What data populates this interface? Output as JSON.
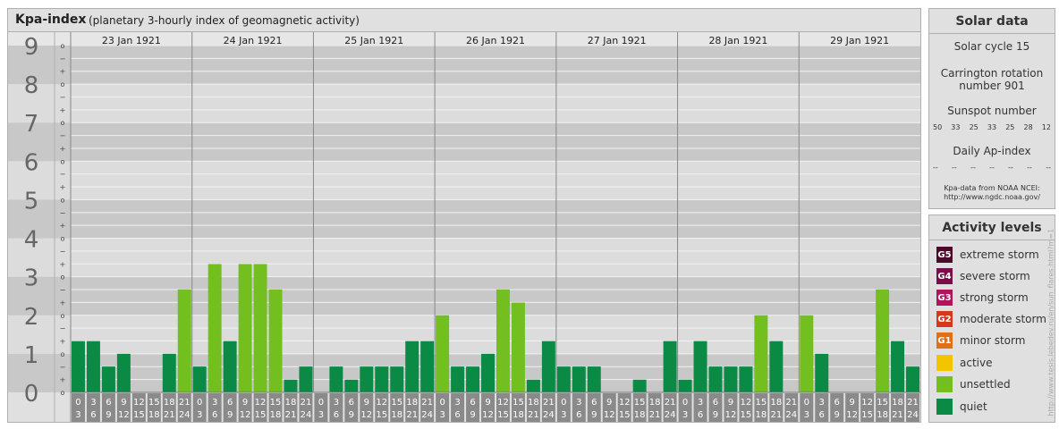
{
  "header": {
    "title": "Kpa-index",
    "subtitle": "(planetary 3-hourly index of geomagnetic activity)"
  },
  "chart_data": {
    "type": "bar",
    "title": "Kpa-index",
    "subtitle": "(planetary 3-hourly index of geomagnetic activity)",
    "ylim": [
      0,
      9
    ],
    "y_major_ticks": [
      "0",
      "1",
      "2",
      "3",
      "4",
      "5",
      "6",
      "7",
      "8",
      "9"
    ],
    "y_minor_tick_marks": [
      "o",
      "+",
      "−"
    ],
    "days": [
      "23 Jan 1921",
      "24 Jan 1921",
      "25 Jan 1921",
      "26 Jan 1921",
      "27 Jan 1921",
      "28 Jan 1921",
      "29 Jan 1921"
    ],
    "slot_start_labels": [
      "0",
      "3",
      "6",
      "9",
      "12",
      "15",
      "18",
      "21"
    ],
    "slot_end_labels": [
      "3",
      "6",
      "9",
      "12",
      "15",
      "18",
      "21",
      "24"
    ],
    "values": [
      [
        1.33,
        1.33,
        0.67,
        1.0,
        0.0,
        0.0,
        1.0,
        2.67
      ],
      [
        0.67,
        3.33,
        1.33,
        3.33,
        3.33,
        2.67,
        0.33,
        0.67
      ],
      [
        0.0,
        0.67,
        0.33,
        0.67,
        0.67,
        0.67,
        1.33,
        1.33
      ],
      [
        2.0,
        0.67,
        0.67,
        1.0,
        2.67,
        2.33,
        0.33,
        1.33
      ],
      [
        0.67,
        0.67,
        0.67,
        0.0,
        0.0,
        0.33,
        0.0,
        1.33
      ],
      [
        0.33,
        1.33,
        0.67,
        0.67,
        0.67,
        2.0,
        1.33,
        0.0
      ],
      [
        2.0,
        1.0,
        0.0,
        0.0,
        0.0,
        2.67,
        1.33,
        0.67
      ]
    ],
    "grid": true,
    "colors": {
      "quiet": "#0a8a44",
      "unsettled": "#72bf1f"
    }
  },
  "solar": {
    "title": "Solar data",
    "cycle": "Solar cycle 15",
    "carrington_line1": "Carrington rotation",
    "carrington_line2": "number 901",
    "sunspot_label": "Sunspot number",
    "sunspot_values": [
      "50",
      "33",
      "25",
      "33",
      "25",
      "28",
      "12"
    ],
    "ap_label": "Daily Ap-index",
    "ap_values": [
      "--",
      "--",
      "--",
      "--",
      "--",
      "--",
      "--"
    ],
    "credit_line1": "Kpa-data from NOAA NCEI:",
    "credit_line2": "http://www.ngdc.noaa.gov/"
  },
  "activity": {
    "title": "Activity levels",
    "items": [
      {
        "code": "G5",
        "label": "extreme storm",
        "color": "#4a0a2a"
      },
      {
        "code": "G4",
        "label": "severe storm",
        "color": "#7a0e4a"
      },
      {
        "code": "G3",
        "label": "strong storm",
        "color": "#b0145a"
      },
      {
        "code": "G2",
        "label": "moderate storm",
        "color": "#d43a1a"
      },
      {
        "code": "G1",
        "label": "minor storm",
        "color": "#e07018"
      },
      {
        "code": "",
        "label": "active",
        "color": "#f5c400"
      },
      {
        "code": "",
        "label": "unsettled",
        "color": "#72bf1f"
      },
      {
        "code": "",
        "label": "quiet",
        "color": "#0a8a44"
      }
    ]
  },
  "watermark": "http://www.tesis.lebedev.ru/en/sun_flares.html?m=1"
}
